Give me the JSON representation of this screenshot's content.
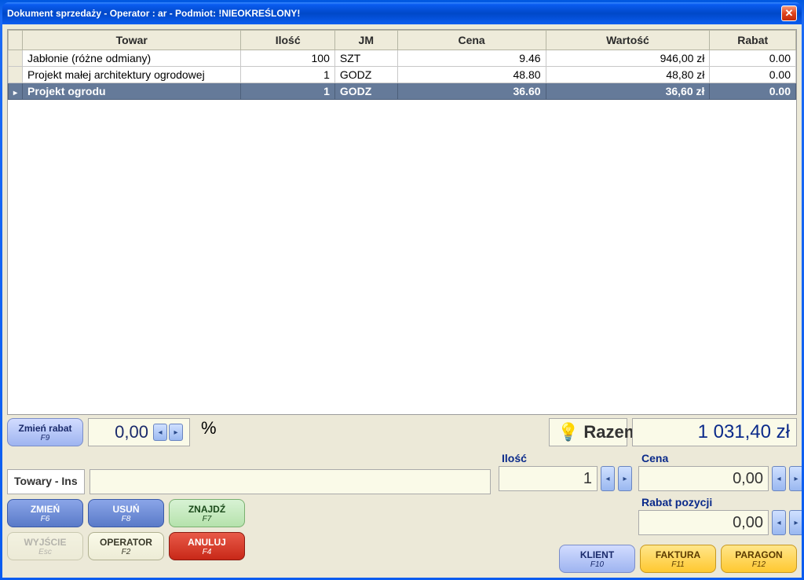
{
  "window": {
    "title": "Dokument sprzedaży - Operator : ar - Podmiot: !NIEOKREŚLONY!"
  },
  "grid": {
    "headers": [
      "Towar",
      "Ilość",
      "JM",
      "Cena",
      "Wartość",
      "Rabat"
    ],
    "rows": [
      {
        "towar": "Jabłonie (różne odmiany)",
        "ilosc": "100",
        "jm": "SZT",
        "cena": "9.46",
        "wartosc": "946,00 zł",
        "rabat": "0.00",
        "selected": false
      },
      {
        "towar": "Projekt małej architektury ogrodowej",
        "ilosc": "1",
        "jm": "GODZ",
        "cena": "48.80",
        "wartosc": "48,80 zł",
        "rabat": "0.00",
        "selected": false
      },
      {
        "towar": "Projekt ogrodu",
        "ilosc": "1",
        "jm": "GODZ",
        "cena": "36.60",
        "wartosc": "36,60 zł",
        "rabat": "0.00",
        "selected": true
      }
    ]
  },
  "discount": {
    "button_label": "Zmień rabat",
    "button_key": "F9",
    "value": "0,00",
    "unit": "%"
  },
  "total": {
    "label": "Razem",
    "value": "1 031,40 zł"
  },
  "fields": {
    "ilosc_label": "Ilość",
    "ilosc_value": "1",
    "cena_label": "Cena",
    "cena_value": "0,00",
    "rabat_label": "Rabat pozycji",
    "rabat_value": "0,00"
  },
  "towary": {
    "label": "Towary - Ins",
    "value": ""
  },
  "buttons": {
    "zmien": {
      "label": "ZMIEŃ",
      "key": "F6"
    },
    "usun": {
      "label": "USUŃ",
      "key": "F8"
    },
    "znajdz": {
      "label": "ZNAJDŹ",
      "key": "F7"
    },
    "wyjscie": {
      "label": "WYJŚCIE",
      "key": "Esc"
    },
    "operator": {
      "label": "OPERATOR",
      "key": "F2"
    },
    "anuluj": {
      "label": "ANULUJ",
      "key": "F4"
    },
    "klient": {
      "label": "KLIENT",
      "key": "F10"
    },
    "faktura": {
      "label": "FAKTURA",
      "key": "F11"
    },
    "paragon": {
      "label": "PARAGON",
      "key": "F12"
    }
  }
}
